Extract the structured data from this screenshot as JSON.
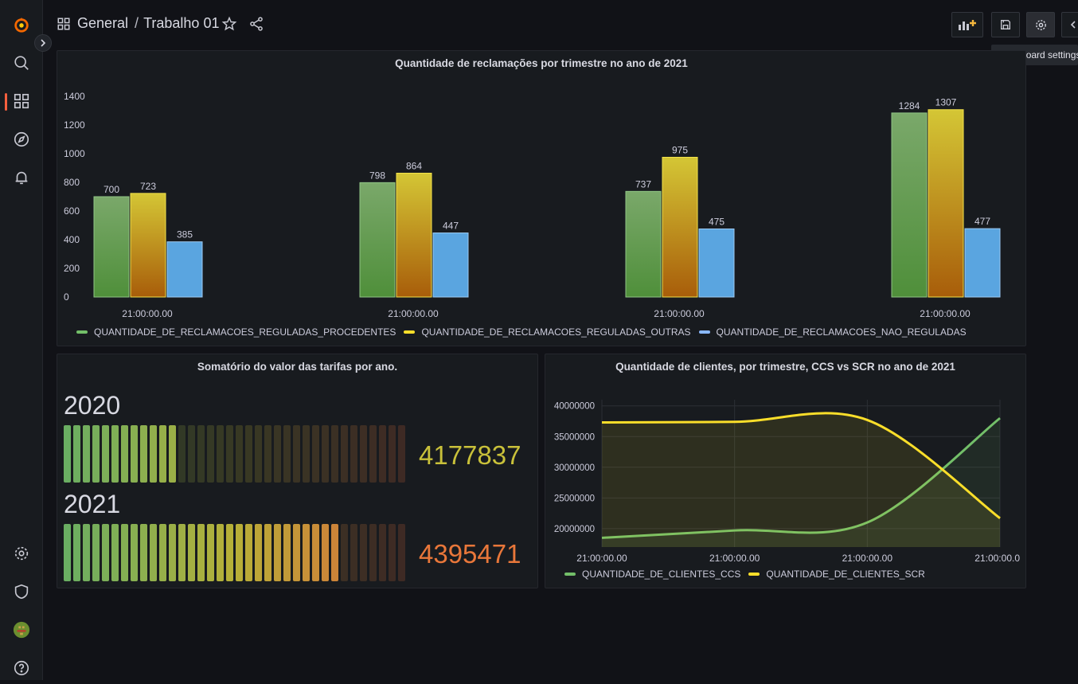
{
  "header": {
    "breadcrumb_folder": "General",
    "breadcrumb_separator": "/",
    "dashboard_title": "Trabalho 01",
    "tooltip": "Dashboard settings"
  },
  "sidebar": {
    "icons": [
      "grafana-logo-icon",
      "search-icon",
      "dashboards-icon",
      "explore-icon",
      "alerting-icon",
      "configuration-icon",
      "server-admin-icon",
      "user-avatar",
      "help-icon"
    ]
  },
  "panels": {
    "bar_panel": {
      "title": "Quantidade de reclamações por trimestre no ano de 2021",
      "legend": [
        {
          "name": "QUANTIDADE_DE_RECLAMACOES_REGULADAS_PROCEDENTES",
          "color": "#73bf69"
        },
        {
          "name": "QUANTIDADE_DE_RECLAMACOES_REGULADAS_OUTRAS",
          "color": "#fade2a"
        },
        {
          "name": "QUANTIDADE_DE_RECLAMACOES_NAO_REGULADAS",
          "color": "#8ab8ff"
        }
      ]
    },
    "gauge_panel": {
      "title": "Somatório do valor das tarifas por ano.",
      "rows": [
        {
          "label": "2020",
          "value": "4177837",
          "fraction": 0.36,
          "value_color": "#c9c13a"
        },
        {
          "label": "2021",
          "value": "4395471",
          "fraction": 0.81,
          "value_color": "#e9773a"
        }
      ]
    },
    "line_panel": {
      "title": "Quantidade de clientes, por trimestre, CCS vs SCR no ano de 2021",
      "legend": [
        {
          "name": "QUANTIDADE_DE_CLIENTES_CCS",
          "color": "#73bf69"
        },
        {
          "name": "QUANTIDADE_DE_CLIENTES_SCR",
          "color": "#fade2a"
        }
      ]
    }
  },
  "chart_data": [
    {
      "type": "bar",
      "title": "Quantidade de reclamações por trimestre no ano de 2021",
      "categories": [
        "21:00:00.00",
        "21:00:00.00",
        "21:00:00.00",
        "21:00:00.00"
      ],
      "series": [
        {
          "name": "QUANTIDADE_DE_RECLAMACOES_REGULADAS_PROCEDENTES",
          "values": [
            700,
            798,
            737,
            1284
          ]
        },
        {
          "name": "QUANTIDADE_DE_RECLAMACOES_REGULADAS_OUTRAS",
          "values": [
            723,
            864,
            975,
            1307
          ]
        },
        {
          "name": "QUANTIDADE_DE_RECLAMACOES_NAO_REGULADAS",
          "values": [
            385,
            447,
            475,
            477
          ]
        }
      ],
      "ylim": [
        0,
        1400
      ],
      "yticks": [
        0,
        200,
        400,
        600,
        800,
        1000,
        1200,
        1400
      ],
      "legend_position": "bottom-left",
      "grid": false
    },
    {
      "type": "line",
      "title": "Quantidade de clientes, por trimestre, CCS vs SCR no ano de 2021",
      "x": [
        "21:00:00.00",
        "21:00:00.00",
        "21:00:00.00",
        "21:00:00.0"
      ],
      "series": [
        {
          "name": "QUANTIDADE_DE_CLIENTES_CCS",
          "values": [
            18500000,
            19700000,
            21000000,
            38000000
          ]
        },
        {
          "name": "QUANTIDADE_DE_CLIENTES_SCR",
          "values": [
            37300000,
            37400000,
            37700000,
            21700000
          ]
        }
      ],
      "ylim": [
        17000000,
        41000000
      ],
      "yticks": [
        20000000,
        25000000,
        30000000,
        35000000,
        40000000
      ],
      "legend_position": "bottom-left",
      "grid": true
    }
  ]
}
